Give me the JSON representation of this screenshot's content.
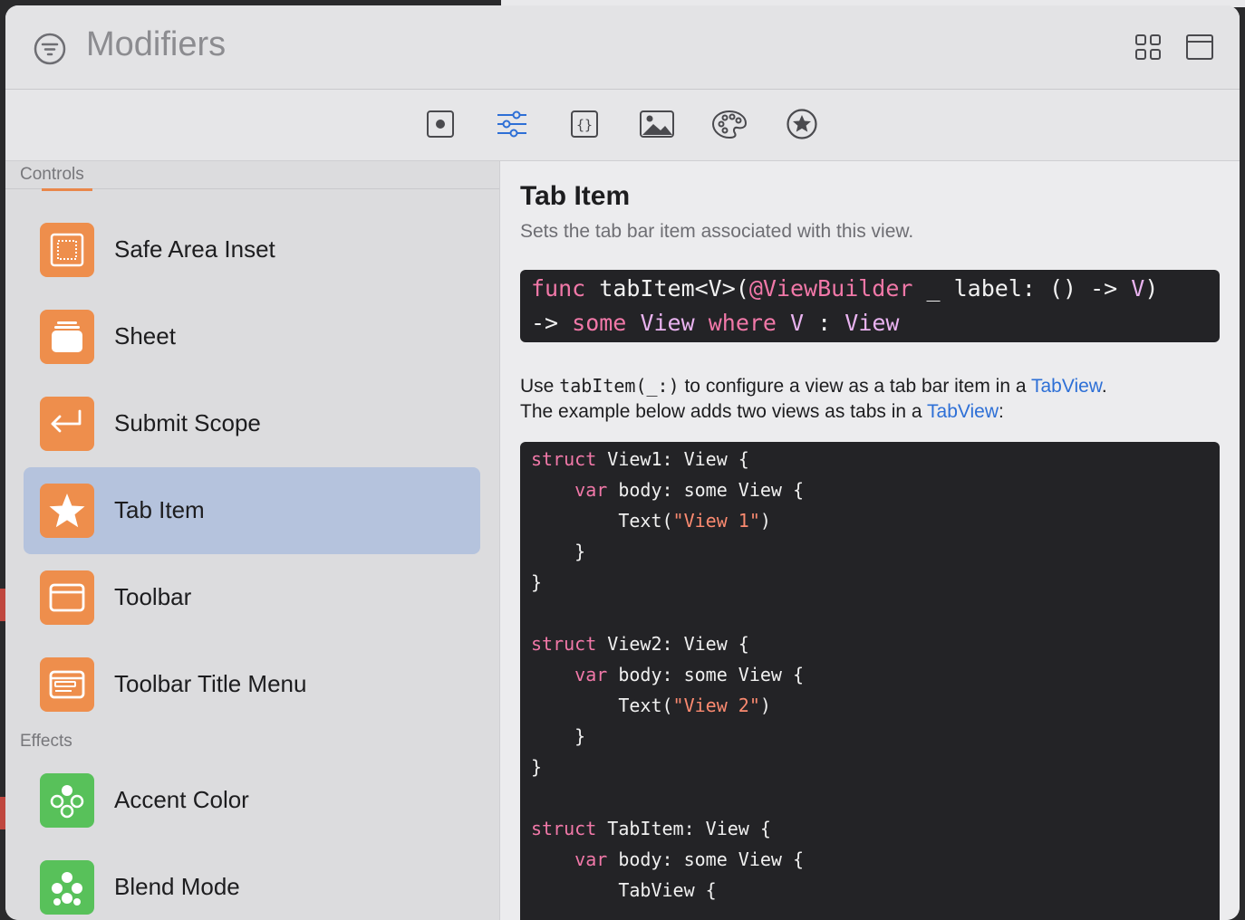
{
  "window": {
    "title": "Modifiers"
  },
  "toolbar": {
    "icons": [
      "record-icon",
      "sliders-icon",
      "braces-icon",
      "photo-icon",
      "palette-icon",
      "star-circle-icon"
    ],
    "active": "sliders-icon"
  },
  "sidebar": {
    "sections": [
      {
        "label": "Controls",
        "items": [
          {
            "label": "Safe Area Inset",
            "icon": "safe-area-icon",
            "color": "#ee8e4c"
          },
          {
            "label": "Sheet",
            "icon": "sheet-icon",
            "color": "#ee8e4c"
          },
          {
            "label": "Submit Scope",
            "icon": "return-icon",
            "color": "#ee8e4c"
          },
          {
            "label": "Tab Item",
            "icon": "star-icon",
            "color": "#ee8e4c",
            "selected": true
          },
          {
            "label": "Toolbar",
            "icon": "toolbar-icon",
            "color": "#ee8e4c"
          },
          {
            "label": "Toolbar Title Menu",
            "icon": "toolbar-title-menu-icon",
            "color": "#ee8e4c"
          }
        ]
      },
      {
        "label": "Effects",
        "items": [
          {
            "label": "Accent Color",
            "icon": "accent-color-icon",
            "color": "#58c15a"
          },
          {
            "label": "Blend Mode",
            "icon": "blend-mode-icon",
            "color": "#58c15a"
          }
        ]
      }
    ]
  },
  "detail": {
    "title": "Tab Item",
    "subtitle": "Sets the tab bar item associated with this view.",
    "signature": {
      "l1_func": "func",
      "l1_name": " tabItem<V>(",
      "l1_attr": "@ViewBuilder",
      "l1_rest": " _ label: () -> ",
      "l1_v": "V",
      "l1_close": ")",
      "l2_arrow": "-> ",
      "l2_some": "some",
      "l2_view": "View",
      "l2_where": "where",
      "l2_v": "V",
      "l2_colon": " : ",
      "l2_view2": "View"
    },
    "description": {
      "p1_a": "Use ",
      "p1_code": "tabItem(_:)",
      "p1_b": " to configure a view as a tab bar item in a ",
      "p1_link": "TabView",
      "p1_c": ".",
      "p2_a": "The example below adds two views as tabs in a ",
      "p2_link": "TabView",
      "p2_b": ":"
    },
    "code": {
      "struct": "struct",
      "var": "var",
      "v1_name": " View1: View {",
      "v2_name": " View2: View {",
      "v3_name": " TabItem: View {",
      "body": " body: some View {",
      "text_open": "Text(",
      "text_close": ")",
      "str1": "\"View 1\"",
      "str2": "\"View 2\"",
      "close": "}",
      "tabview": "TabView {"
    }
  },
  "colors": {
    "accent": "#2d6fd6",
    "selection": "#b5c3dd",
    "keyword": "#f178a8",
    "string": "#fb8a70"
  }
}
